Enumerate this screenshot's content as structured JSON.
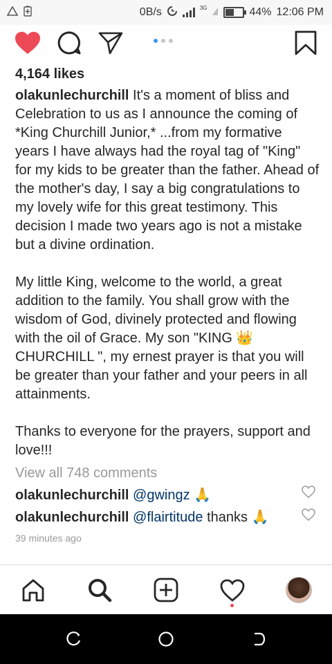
{
  "status_bar": {
    "net_speed": "0B/s",
    "network_type": "3G",
    "battery_percent": "44%",
    "battery_level": 0.44,
    "time": "12:06 PM"
  },
  "post": {
    "likes": "4,164 likes",
    "username": "olakunlechurchill",
    "caption_paragraphs": [
      "It's a moment of bliss and Celebration to us as I announce the coming of *King Churchill Junior,* ...from my formative years I have always had the royal tag of \"King\" for my kids to be greater than the father. Ahead of the mother's day, I say a big congratulations to my lovely wife for this great testimony. This decision I made two years ago is not a mistake but a divine ordination.",
      "My little King, welcome to the world, a great addition to the family. You shall grow with the wisdom of God, divinely protected and flowing with the oil of Grace. My son \"KING 👑 CHURCHILL \", my ernest prayer is that you will be greater than your father and your peers in all attainments.",
      "Thanks to everyone for the prayers, support and love!!!"
    ],
    "view_all_comments": "View all 748 comments",
    "comments": [
      {
        "username": "olakunlechurchill",
        "mention": "@gwingz",
        "text": " 🙏"
      },
      {
        "username": "olakunlechurchill",
        "mention": "@flairtitude",
        "text": " thanks 🙏"
      }
    ],
    "timestamp": "39 minutes ago",
    "carousel_pages": 3,
    "carousel_active": 1
  },
  "colors": {
    "like_red": "#ed4956",
    "mention_blue": "#003569",
    "carousel_active": "#3897f0"
  },
  "icons": {
    "actions": [
      "heart-filled-icon",
      "comment-icon",
      "share-icon",
      "bookmark-icon"
    ],
    "tabs": [
      "home-icon",
      "search-icon",
      "add-post-icon",
      "activity-heart-icon",
      "profile-avatar"
    ],
    "android_nav": [
      "recents-icon",
      "home-circle-icon",
      "back-icon"
    ]
  }
}
